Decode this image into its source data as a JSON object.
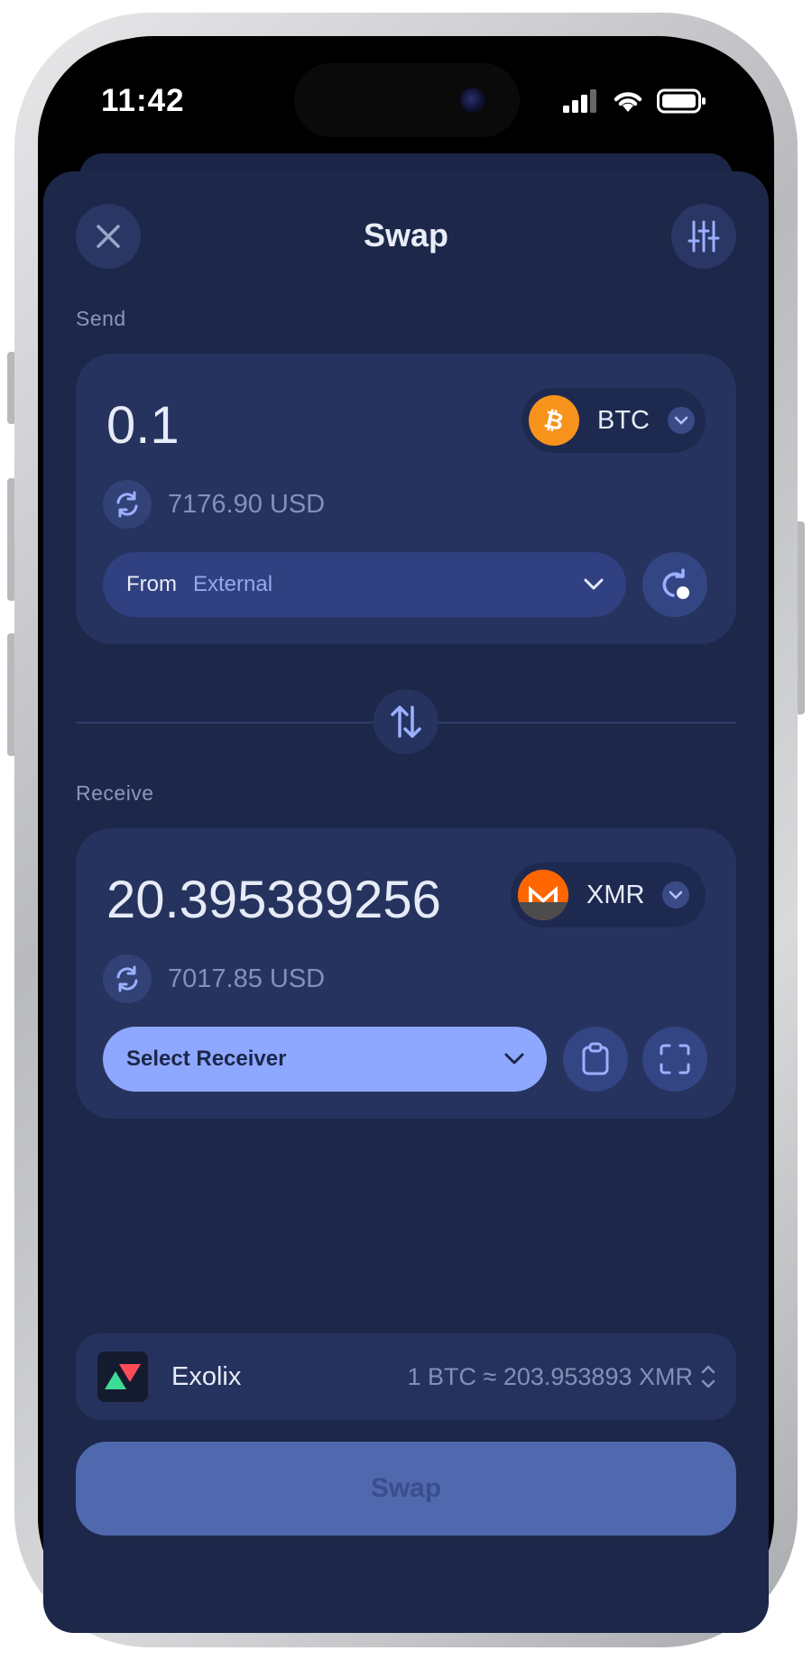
{
  "status_bar": {
    "time": "11:42"
  },
  "header": {
    "title": "Swap",
    "close_icon": "close-icon",
    "settings_icon": "sliders-icon"
  },
  "send": {
    "section_label": "Send",
    "amount": "0.1",
    "coin": {
      "symbol": "BTC",
      "icon": "bitcoin-icon",
      "color": "#f7931a"
    },
    "usd_value": "7176.90 USD",
    "from_label": "From",
    "from_value": "External"
  },
  "receive": {
    "section_label": "Receive",
    "amount": "20.395389256",
    "coin": {
      "symbol": "XMR",
      "icon": "monero-icon",
      "color": "#ff6600"
    },
    "usd_value": "7017.85 USD",
    "receiver_placeholder": "Select Receiver"
  },
  "provider": {
    "name": "Exolix",
    "rate": "1 BTC ≈ 203.953893 XMR"
  },
  "swap_button_label": "Swap",
  "colors": {
    "background": "#1c2749",
    "card": "#26335e",
    "accent": "#8ea8ff"
  }
}
